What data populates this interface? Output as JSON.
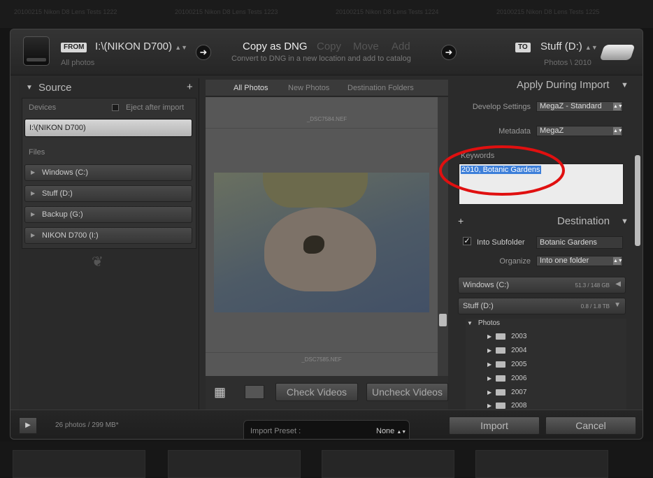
{
  "background": {
    "top_strip": [
      "20100215 Nikon D8 Lens Tests 1222",
      "20100215 Nikon D8 Lens Tests 1223",
      "20100215 Nikon D8 Lens Tests 1224",
      "20100215 Nikon D8 Lens Tests 1225"
    ]
  },
  "header": {
    "from_tag": "FROM",
    "from_source": "I:\\(NIKON D700)",
    "from_sub": "All photos",
    "modes": [
      {
        "label": "Copy as DNG",
        "active": true
      },
      {
        "label": "Copy",
        "active": false
      },
      {
        "label": "Move",
        "active": false
      },
      {
        "label": "Add",
        "active": false
      }
    ],
    "mode_description": "Convert to DNG in a new location and add to catalog",
    "to_tag": "TO",
    "to_dest": "Stuff (D:)",
    "to_sub": "Photos \\ 2010",
    "arrow": "➜"
  },
  "source": {
    "title": "Source",
    "add": "+",
    "devices_label": "Devices",
    "eject_label": "Eject after import",
    "selected_device": "I:\\(NIKON D700)",
    "files_label": "Files",
    "drives": [
      "Windows (C:)",
      "Stuff (D:)",
      "Backup (G:)",
      "NIKON D700 (I:)"
    ]
  },
  "center": {
    "tabs": [
      "All Photos",
      "New Photos",
      "Destination Folders"
    ],
    "active_tab": "All Photos",
    "file_top": "_DSC7584.NEF",
    "file_bottom": "_DSC7585.NEF",
    "check_videos": "Check Videos",
    "uncheck_videos": "Uncheck Videos"
  },
  "right": {
    "apply_title": "Apply During Import",
    "develop_label": "Develop Settings",
    "develop_value": "MegaZ - Standard",
    "metadata_label": "Metadata",
    "metadata_value": "MegaZ",
    "keywords_label": "Keywords",
    "keywords_value": "2010, Botanic Gardens",
    "destination_title": "Destination",
    "into_subfolder_label": "Into Subfolder",
    "subfolder_value": "Botanic Gardens",
    "organize_label": "Organize",
    "organize_value": "Into one folder",
    "volumes": [
      {
        "name": "Windows (C:)",
        "size": "51.3 / 148 GB"
      },
      {
        "name": "Stuff (D:)",
        "size": "0.8 / 1.8 TB"
      }
    ],
    "root_folder": "Photos",
    "folders": [
      "2003",
      "2004",
      "2005",
      "2006",
      "2007",
      "2008"
    ]
  },
  "footer": {
    "count": "26 photos / 299 MB*",
    "preset_label": "Import Preset :",
    "preset_value": "None",
    "import": "Import",
    "cancel": "Cancel"
  },
  "colors": {
    "highlight": "#3d7fd9",
    "annotation": "#e01010"
  }
}
